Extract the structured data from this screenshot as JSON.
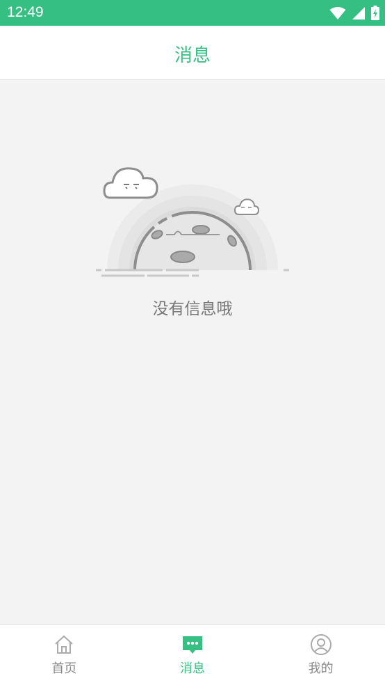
{
  "status_bar": {
    "time": "12:49",
    "icons": [
      "wifi-icon",
      "signal-icon",
      "battery-charging-icon"
    ]
  },
  "header": {
    "title": "消息"
  },
  "empty_state": {
    "message": "没有信息哦",
    "illustration": "sleeping-moon-illustration"
  },
  "tab_bar": {
    "active_index": 1,
    "accent_color": "#36bf83",
    "tabs": [
      {
        "label": "首页",
        "icon": "home-icon"
      },
      {
        "label": "消息",
        "icon": "message-icon"
      },
      {
        "label": "我的",
        "icon": "profile-icon"
      }
    ]
  },
  "colors": {
    "status_bar": "#36bf83",
    "header_title": "#36bf83",
    "background": "#f3f3f3",
    "inactive": "#888888"
  }
}
